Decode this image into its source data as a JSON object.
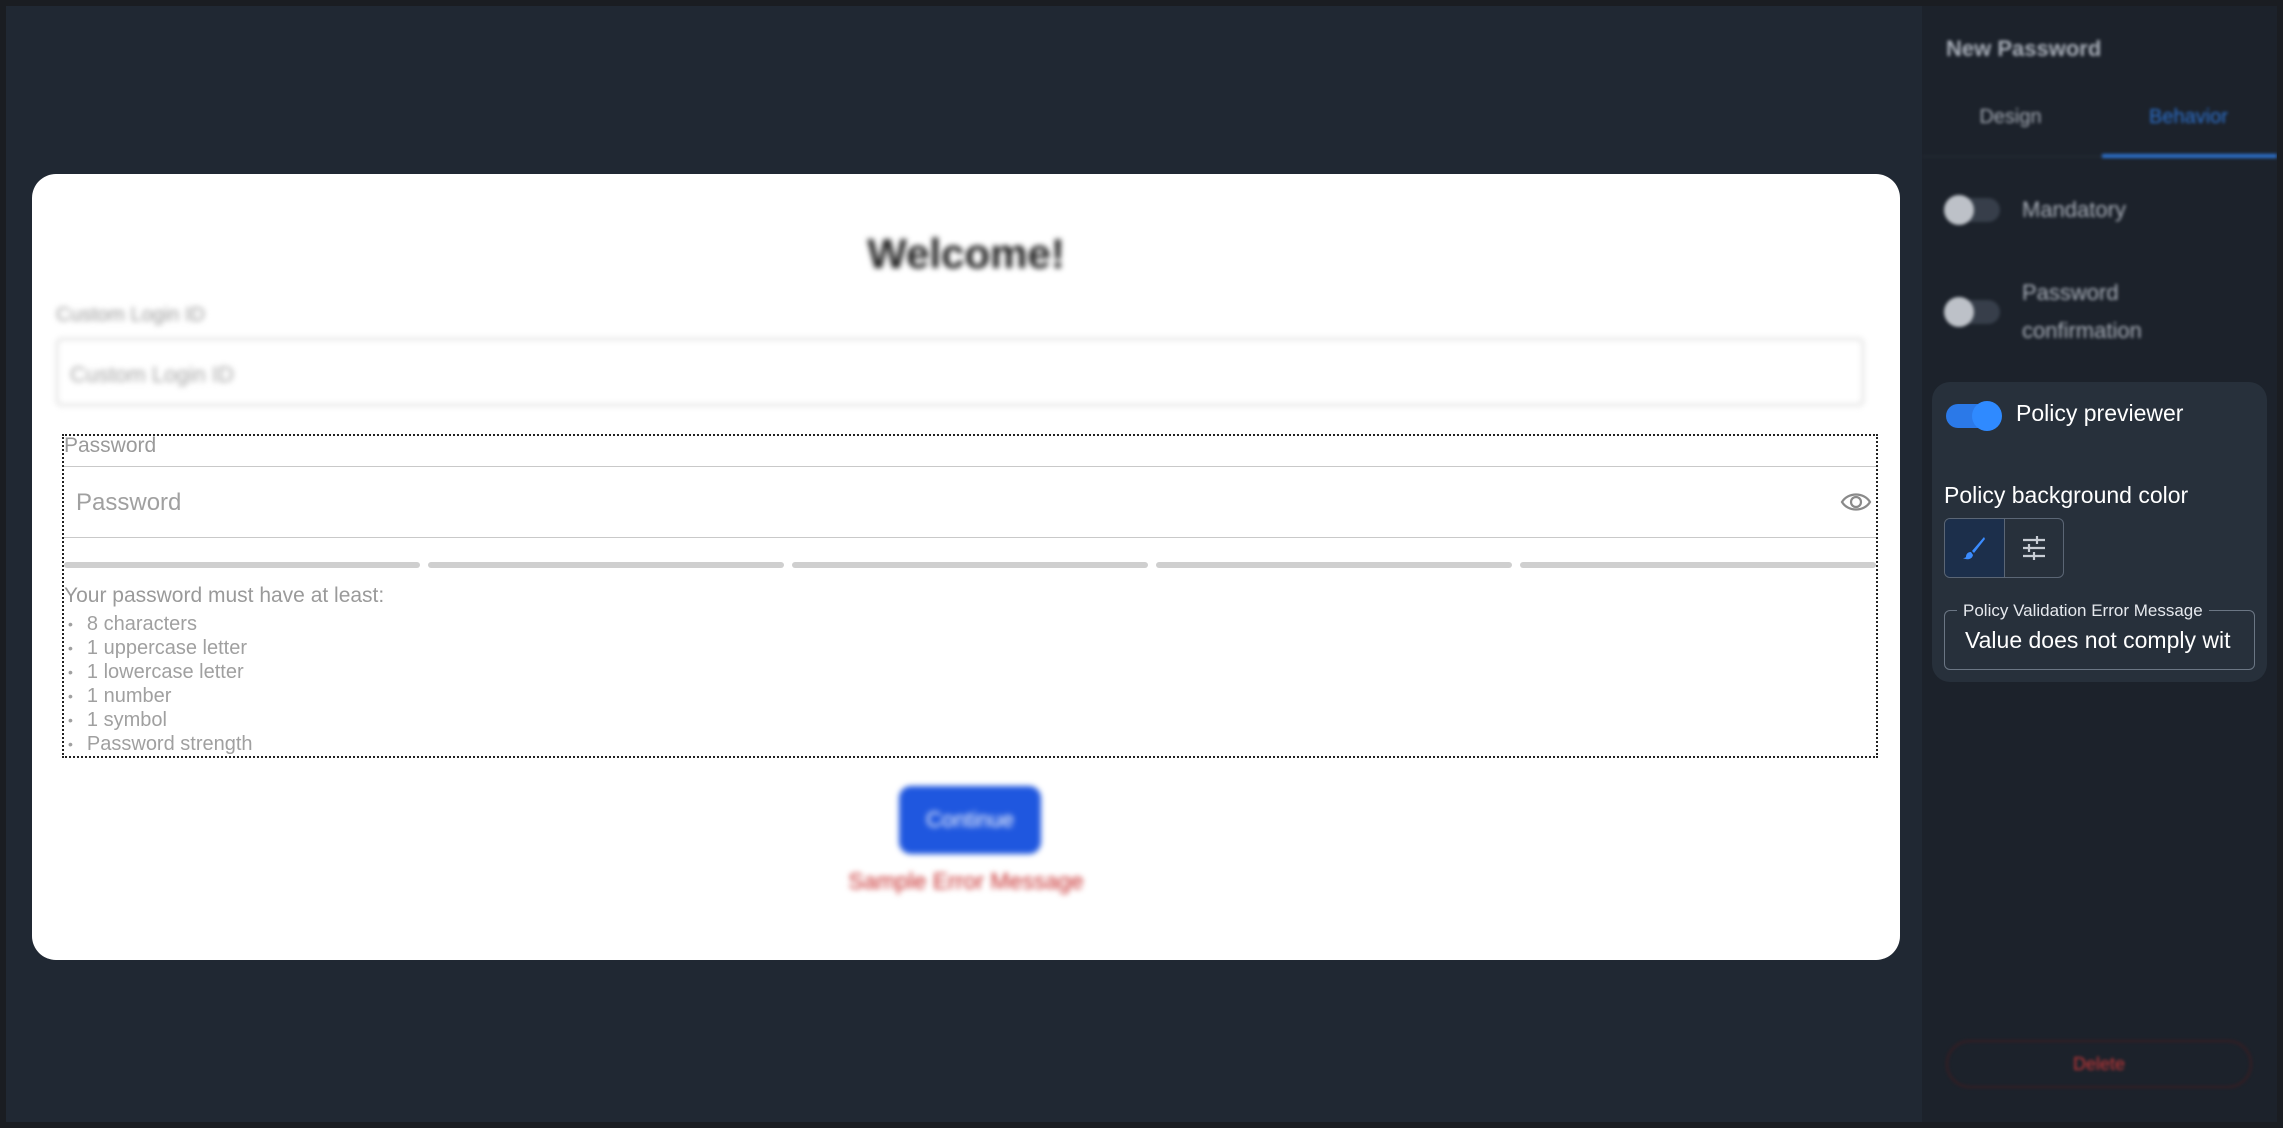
{
  "canvas": {
    "card": {
      "title": "Welcome!",
      "login_label": "Custom Login ID",
      "login_placeholder": "Custom Login ID",
      "password_label": "Password",
      "password_placeholder": "Password",
      "rules_title": "Your password must have at least:",
      "rules": [
        "8 characters",
        "1 uppercase letter",
        "1 lowercase letter",
        "1 number",
        "1 symbol",
        "Password strength"
      ],
      "continue_label": "Continue",
      "error_message": "Sample Error Message"
    }
  },
  "panel": {
    "title": "New Password",
    "tabs": [
      {
        "label": "Design",
        "active": false
      },
      {
        "label": "Behavior",
        "active": true
      }
    ],
    "mandatory": {
      "label": "Mandatory",
      "on": false
    },
    "password_confirmation": {
      "label_line1": "Password",
      "label_line2": "confirmation",
      "on": false
    },
    "policy_previewer": {
      "label": "Policy previewer",
      "on": true
    },
    "policy_bg_color_label": "Policy background color",
    "policy_validation": {
      "legend": "Policy Validation Error Message",
      "value": "Value does not comply wit"
    },
    "delete_label": "Delete"
  },
  "colors": {
    "accent": "#2f7ae0",
    "continue_button": "#1f57df",
    "error": "#c62828"
  }
}
